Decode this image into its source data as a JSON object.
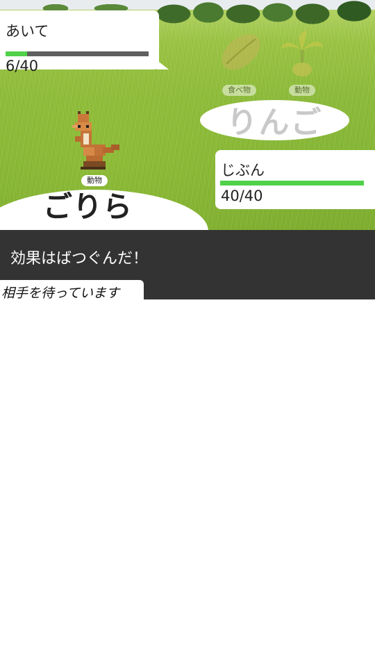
{
  "opponent": {
    "label": "あいて",
    "hp_text": "6/40",
    "hp_fraction": 0.15,
    "name": "りんご",
    "category_food": "食べ物",
    "category_animal": "動物"
  },
  "self": {
    "label": "じぶん",
    "hp_text": "40/40",
    "hp_fraction": 1.0,
    "name": "ごりら",
    "category": "動物"
  },
  "message": "効果はばつぐんだ！",
  "waiting": "相手を待っています",
  "colors": {
    "hp_fill": "#4fd14a",
    "hp_empty": "#5f5f5f",
    "message_bg": "#333333"
  }
}
